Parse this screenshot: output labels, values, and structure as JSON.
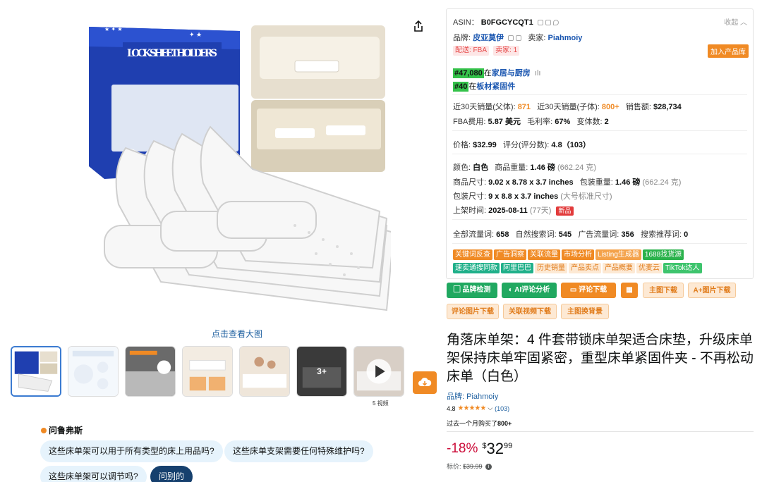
{
  "product": {
    "view_large": "点击查看大图",
    "box_text": "LOCK SHEET HOLDERS",
    "thumb_more": "3+",
    "video_count": "5 视频"
  },
  "rufus": {
    "title": "问鲁弗斯",
    "chips": [
      "这些床单架可以用于所有类型的床上用品吗?",
      "这些床单支架需要任何特殊维护吗?",
      "这些床单架可以调节吗?",
      "问别的"
    ]
  },
  "panel": {
    "asin_label": "ASIN：",
    "asin": "B0FGCYCQT1",
    "collapse": "收起",
    "brand_label": "品牌:",
    "brand": "皮亚莫伊",
    "seller_label": "卖家:",
    "seller": "Piahmoiy",
    "delivery": "配送: FBA",
    "seller_count": "卖家: 1",
    "add_library": "加入产品库",
    "rank1": "#47,080",
    "rank1_in": "在",
    "rank1_cat": "家居与厨房",
    "rank2": "#40",
    "rank2_in": "在",
    "rank2_cat": "板材紧固件",
    "sales30_label": "近30天销量(父体):",
    "sales30": "871",
    "sales30c_label": "近30天销量(子体):",
    "sales30c": "800+",
    "revenue_label": "销售额:",
    "revenue": "$28,734",
    "fba_label": "FBA费用:",
    "fba": "5.87 美元",
    "margin_label": "毛利率:",
    "margin": "67%",
    "variants_label": "变体数:",
    "variants": "2",
    "price_label": "价格:",
    "price": "$32.99",
    "rating_label": "评分(评分数):",
    "rating": "4.8（103）",
    "color_label": "颜色:",
    "color": "白色",
    "weight_label": "商品重量:",
    "weight": "1.46 磅",
    "weight_g": "(662.24 克)",
    "size_label": "商品尺寸:",
    "size": "9.02 x 8.78 x 3.7 inches",
    "pkg_weight_label": "包装重量:",
    "pkg_weight": "1.46 磅",
    "pkg_weight_g": "(662.24 克)",
    "pkg_size_label": "包装尺寸:",
    "pkg_size": "9 x 8.8 x 3.7 inches",
    "pkg_size_note": "(大号标准尺寸)",
    "listed_label": "上架时间:",
    "listed": "2025-08-11",
    "listed_days": "(77天)",
    "new_badge": "新品",
    "traffic_label": "全部流量词:",
    "traffic": "658",
    "organic_label": "自然搜索词:",
    "organic": "545",
    "ads_label": "广告流量词:",
    "ads": "356",
    "rec_label": "搜索推荐词:",
    "rec": "0",
    "tags_row1": [
      "关键词反查",
      "广告洞察",
      "关联流量",
      "市场分析",
      "Listing生成器",
      "1688找货源"
    ],
    "tags_row2": [
      "速卖通搜同款",
      "阿里巴巴",
      "历史销量",
      "产品卖点",
      "产品概要",
      "优麦云",
      "TikTok达人"
    ]
  },
  "actions": {
    "brand_check": "品牌检测",
    "ai_review": "AI评论分析",
    "review_download": "评论下载",
    "main_image_download": "主图下载",
    "aplus_download": "A+图片下载",
    "review_image_download": "评论图片下载",
    "video_download": "关联视频下载",
    "replace_bg": "主图换背景"
  },
  "listing": {
    "title": "角落床单架：4 件套带锁床单架适合床垫，升级床单架保持床单牢固紧密，重型床单紧固件夹 - 不再松动床单（白色）",
    "brand": "品牌: Piahmoiy",
    "rating": "4.8",
    "stars": "★★★★★",
    "rating_count": "(103)",
    "bought_prefix": "过去一个月购买了",
    "bought_count": "800+",
    "discount": "-18%",
    "currency": "$",
    "price_whole": "32",
    "price_frac": "99",
    "list_label": "标价:",
    "list_price": "$39.99"
  },
  "colors": {
    "accent_orange": "#f08a24",
    "green": "#20a860",
    "link_blue": "#2162a1",
    "discount_red": "#cc0c39"
  }
}
